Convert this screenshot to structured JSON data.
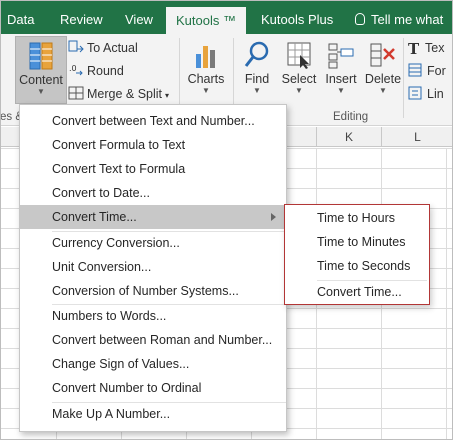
{
  "tabs": [
    {
      "label": "Data"
    },
    {
      "label": "Review"
    },
    {
      "label": "View"
    },
    {
      "label": "Kutools ™"
    },
    {
      "label": "Kutools Plus"
    }
  ],
  "tell_me": "Tell me what",
  "ribbon": {
    "content": "Content",
    "to_actual": "To Actual",
    "round": "Round",
    "merge_split": "Merge & Split",
    "charts": "Charts",
    "find": "Find",
    "select": "Select",
    "insert": "Insert",
    "delete": "Delete",
    "text": "Tex",
    "format": "For",
    "link": "Lin",
    "group_partial": "es &",
    "group_editing": "Editing"
  },
  "columns": [
    "K",
    "L"
  ],
  "menu": {
    "items": [
      {
        "label": "Convert between Text and Number..."
      },
      {
        "label": "Convert Formula to Text"
      },
      {
        "label": "Convert Text to Formula"
      },
      {
        "label": "Convert to Date..."
      },
      {
        "label": "Convert Time..."
      },
      {
        "label": "Currency Conversion..."
      },
      {
        "label": "Unit Conversion..."
      },
      {
        "label": "Conversion of Number Systems..."
      },
      {
        "label": "Numbers to Words..."
      },
      {
        "label": "Convert between Roman and Number..."
      },
      {
        "label": "Change Sign of Values..."
      },
      {
        "label": "Convert Number to Ordinal"
      },
      {
        "label": "Make Up A Number..."
      }
    ]
  },
  "submenu": {
    "items": [
      {
        "label": "Time to Hours"
      },
      {
        "label": "Time to Minutes"
      },
      {
        "label": "Time to Seconds"
      },
      {
        "label": "Convert Time..."
      }
    ]
  },
  "colors": {
    "excel_green": "#217346",
    "highlight": "#c8c8c8",
    "submenu_border": "#b23636"
  }
}
